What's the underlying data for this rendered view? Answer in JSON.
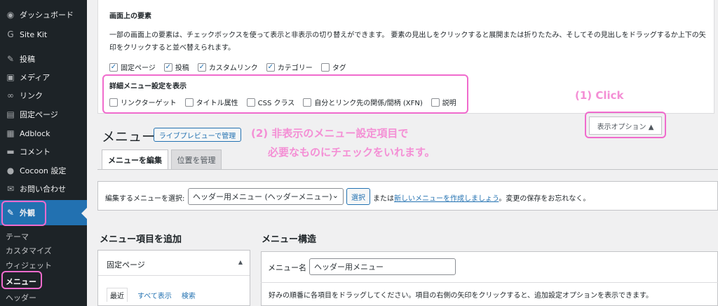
{
  "sidebar": {
    "items": [
      {
        "label": "ダッシュボード",
        "icon": "dashboard-icon",
        "glyph": "◉"
      },
      {
        "label": "Site Kit",
        "icon": "google-icon",
        "glyph": "G"
      },
      {
        "label": "投稿",
        "icon": "pin-icon",
        "glyph": "✎"
      },
      {
        "label": "メディア",
        "icon": "media-icon",
        "glyph": "▣"
      },
      {
        "label": "リンク",
        "icon": "link-icon",
        "glyph": "∞"
      },
      {
        "label": "固定ページ",
        "icon": "page-icon",
        "glyph": "▤"
      },
      {
        "label": "Adblock",
        "icon": "adblock-icon",
        "glyph": "▦"
      },
      {
        "label": "コメント",
        "icon": "comment-icon",
        "glyph": "▬"
      },
      {
        "label": "Cocoon 設定",
        "icon": "cocoon-icon",
        "glyph": "●"
      },
      {
        "label": "お問い合わせ",
        "icon": "mail-icon",
        "glyph": "✉"
      }
    ],
    "active": {
      "label": "外観",
      "icon": "appearance-icon",
      "glyph": "✎"
    },
    "submenu": [
      "テーマ",
      "カスタマイズ",
      "ウィジェット",
      "メニュー",
      "ヘッダー"
    ]
  },
  "screen_options": {
    "title": "画面上の要素",
    "description": "一部の画面上の要素は、チェックボックスを使って表示と非表示の切り替えができます。 要素の見出しをクリックすると展開または折りたたみ、そしてその見出しをドラッグするか上下の矢印をクリックすると並べ替えられます。",
    "boxes": [
      {
        "label": "固定ページ",
        "checked": true
      },
      {
        "label": "投稿",
        "checked": true
      },
      {
        "label": "カスタムリンク",
        "checked": true
      },
      {
        "label": "カテゴリー",
        "checked": true
      },
      {
        "label": "タグ",
        "checked": false
      }
    ],
    "advanced_title": "詳細メニュー設定を表示",
    "advanced": [
      {
        "label": "リンクターゲット",
        "checked": false
      },
      {
        "label": "タイトル属性",
        "checked": false
      },
      {
        "label": "CSS クラス",
        "checked": false
      },
      {
        "label": "自分とリンク先の関係/間柄 (XFN)",
        "checked": false
      },
      {
        "label": "説明",
        "checked": false
      }
    ],
    "toggle_label": "表示オプション ▲"
  },
  "annotations": {
    "click": "(1) Click",
    "step2_line1": "(2) 非表示のメニュー設定項目で",
    "step2_line2": "必要なものにチェックをいれます。"
  },
  "page": {
    "title": "メニュー",
    "live_preview": "ライブプレビューで管理",
    "tabs": [
      "メニューを編集",
      "位置を管理"
    ]
  },
  "manage": {
    "label": "編集するメニューを選択:",
    "selected": "ヘッダー用メニュー (ヘッダーメニュー)",
    "select_button": "選択",
    "or_text": "または",
    "create_link": "新しいメニューを作成しましょう",
    "save_note": "。変更の保存をお忘れなく。"
  },
  "add_items": {
    "heading": "メニュー項目を追加",
    "panel_title": "固定ページ",
    "tabs": [
      "最近",
      "すべて表示",
      "検索"
    ]
  },
  "structure": {
    "heading": "メニュー構造",
    "name_label": "メニュー名",
    "name_value": "ヘッダー用メニュー",
    "hint": "好みの順番に各項目をドラッグしてください。項目の右側の矢印をクリックすると、追加設定オプションを表示できます。"
  },
  "colors": {
    "accent": "#2271b1",
    "annotation": "#f06bcd",
    "sidebar": "#1d2327"
  }
}
